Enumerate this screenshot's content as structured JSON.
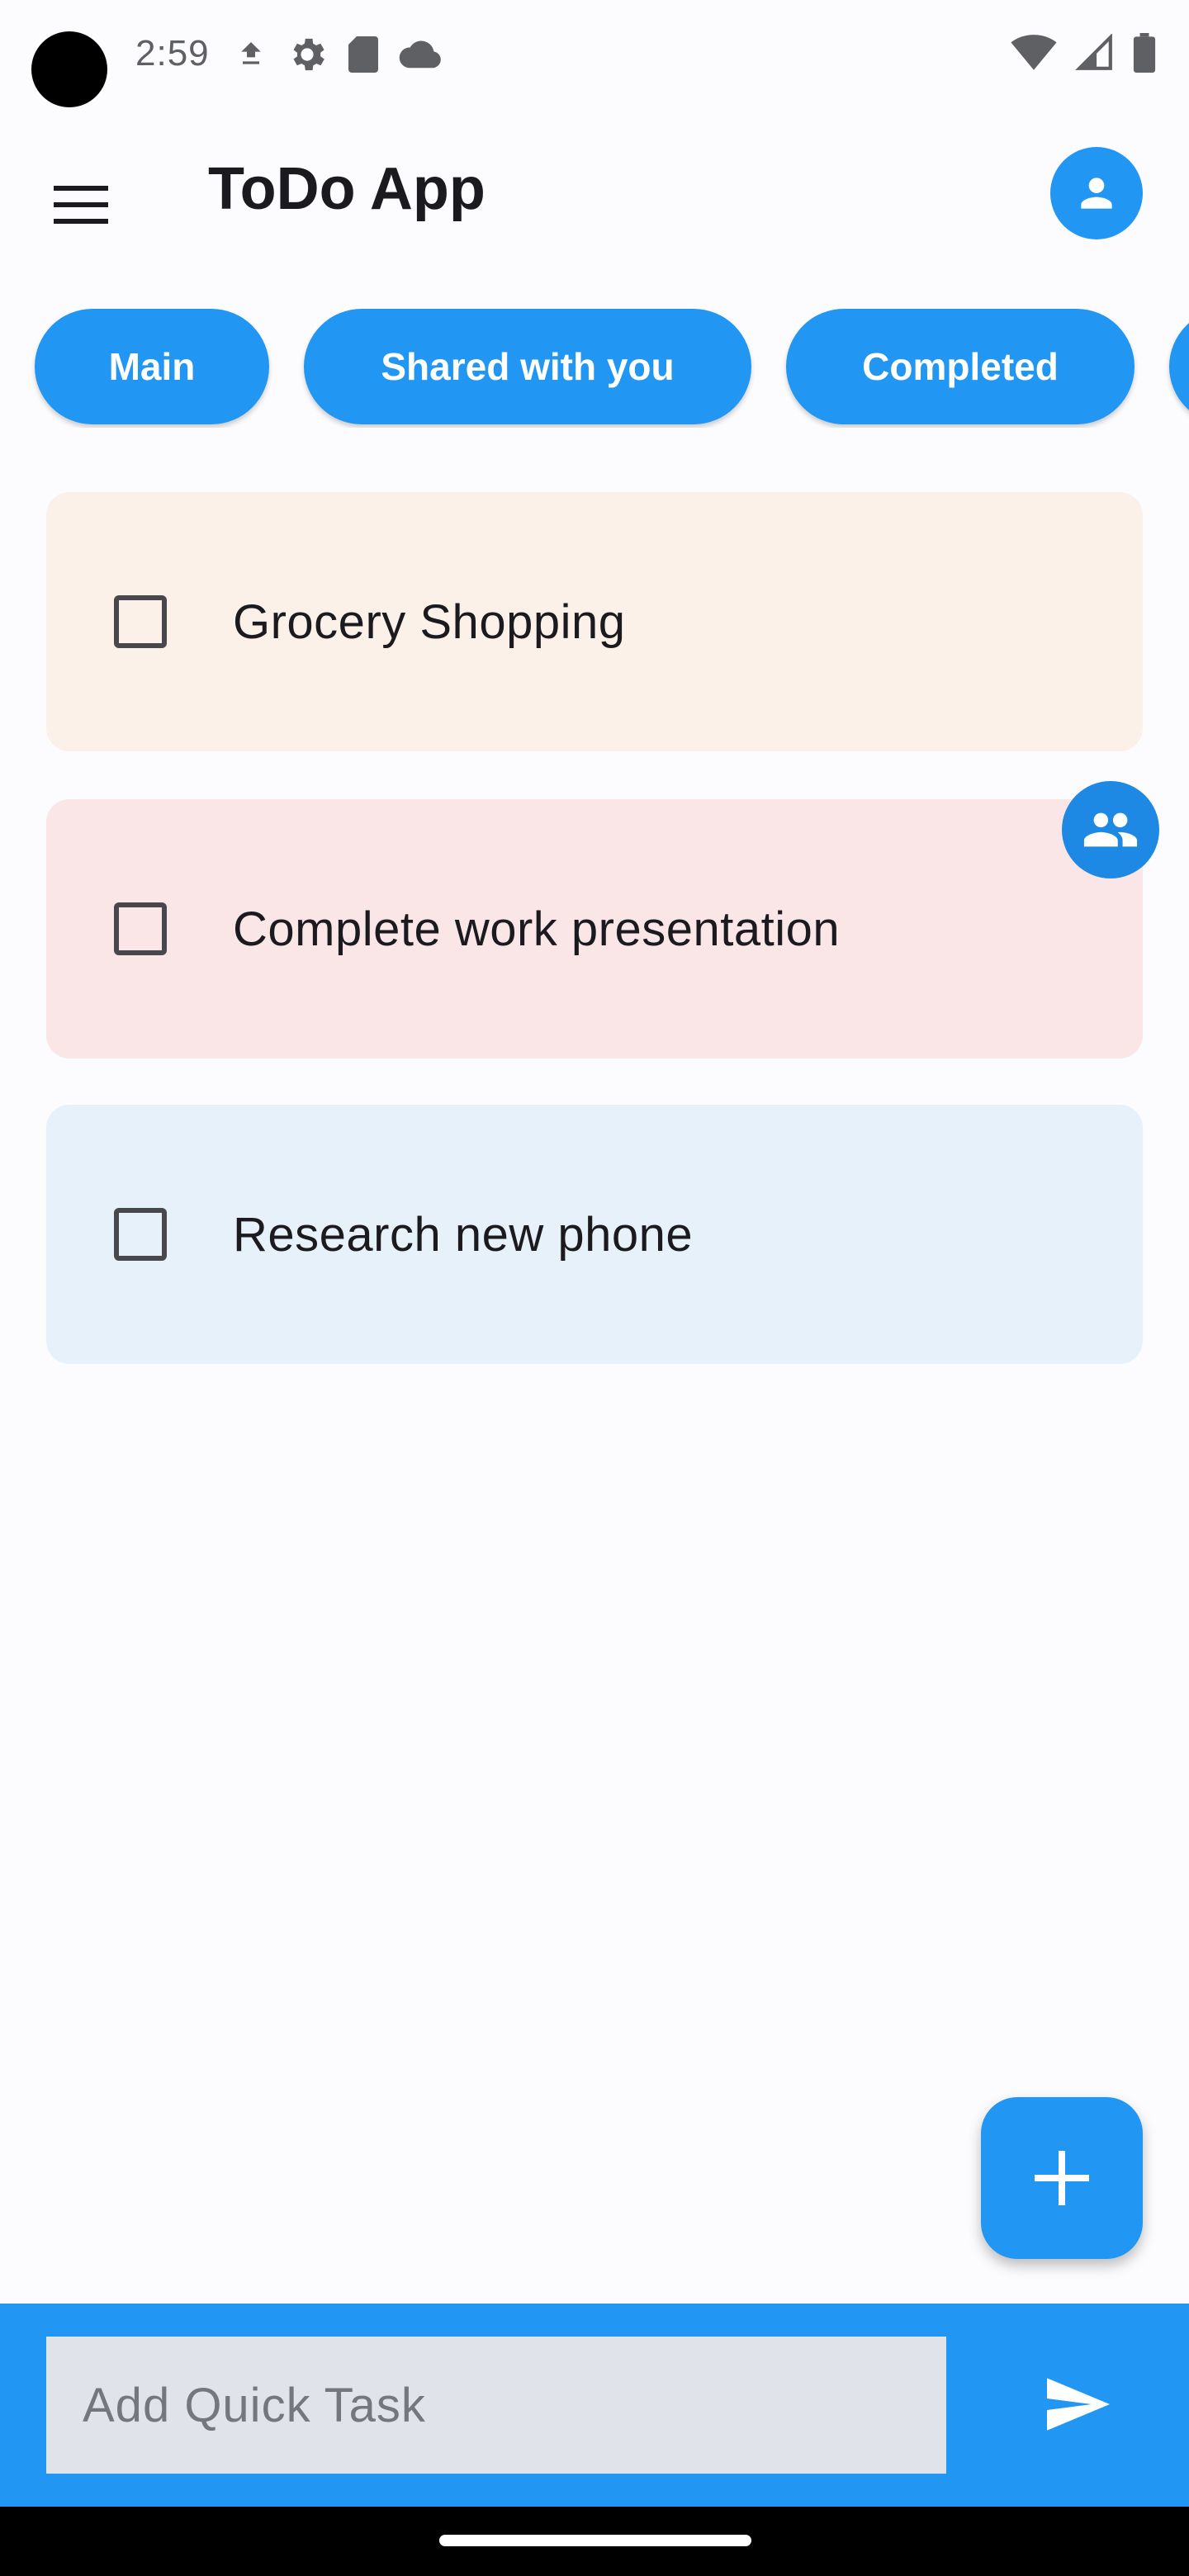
{
  "status_bar": {
    "time": "2:59",
    "left_icons": [
      "download-icon",
      "settings-gear-icon",
      "sd-card-icon",
      "cloud-icon"
    ],
    "right_icons": [
      "wifi-icon",
      "cell-signal-icon",
      "battery-icon"
    ]
  },
  "app_bar": {
    "title": "ToDo App",
    "menu_icon": "hamburger-menu-icon",
    "profile_icon": "person-icon"
  },
  "tabs": [
    {
      "label": "Main"
    },
    {
      "label": "Shared with you"
    },
    {
      "label": "Completed"
    },
    {
      "label": ""
    }
  ],
  "tasks": [
    {
      "title": "Grocery Shopping",
      "checked": false,
      "color": "#FBF1E8",
      "shared": false
    },
    {
      "title": "Complete work presentation",
      "checked": false,
      "color": "#FAE6E7",
      "shared": true
    },
    {
      "title": "Research new phone",
      "checked": false,
      "color": "#E7F1FA",
      "shared": false
    }
  ],
  "fab": {
    "icon": "plus-icon"
  },
  "quick_add": {
    "placeholder": "Add Quick Task",
    "value": "",
    "send_icon": "send-icon"
  },
  "colors": {
    "accent": "#2196F3",
    "background": "#FCFCFF",
    "input_bg": "#E0E3EA"
  }
}
